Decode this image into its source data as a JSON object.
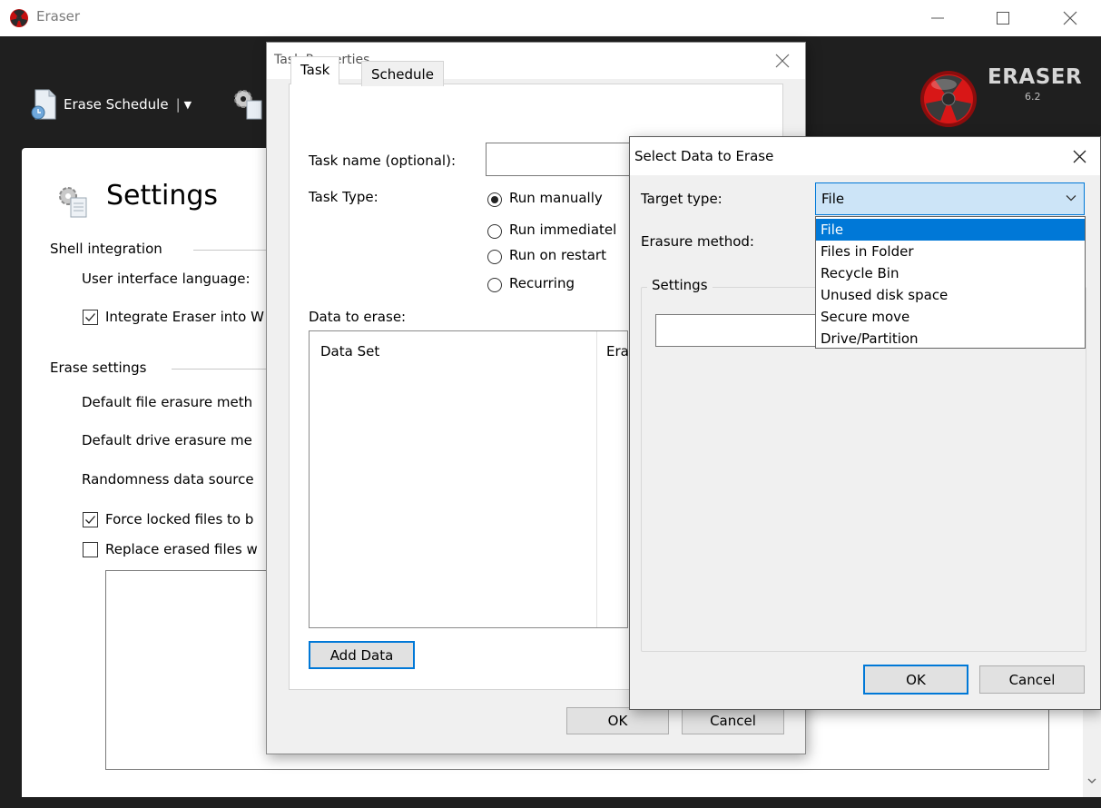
{
  "window": {
    "title": "Eraser",
    "minimize_label": "—",
    "close_label": "✕"
  },
  "toolbar": {
    "erase_schedule_label": "Erase Schedule",
    "separator": "|",
    "dropdown_arrow": "▼"
  },
  "brand": {
    "name": "ERASER",
    "version": "6.2"
  },
  "settings": {
    "title": "Settings",
    "shell_section": "Shell integration",
    "ui_language_label": "User interface language:",
    "integrate_label": "Integrate Eraser into W",
    "integrate_checked": true,
    "erase_section": "Erase settings",
    "default_file_method": "Default file erasure meth",
    "default_drive_method": "Default drive erasure me",
    "randomness_source": "Randomness data source",
    "force_locked_label": "Force locked files to b",
    "force_locked_checked": true,
    "replace_erased_label": "Replace erased files w",
    "replace_erased_checked": false
  },
  "task_dialog": {
    "title": "Task Properties",
    "tabs": [
      {
        "label": "Task",
        "active": true
      },
      {
        "label": "Schedule",
        "active": false
      }
    ],
    "task_name_label": "Task name (optional):",
    "task_name_value": "",
    "task_type_label": "Task Type:",
    "task_types": [
      {
        "label": "Run manually",
        "selected": true
      },
      {
        "label": "Run immediatel",
        "selected": false
      },
      {
        "label": "Run on restart",
        "selected": false
      },
      {
        "label": "Recurring",
        "selected": false
      }
    ],
    "data_to_erase_label": "Data to erase:",
    "columns": [
      "Data Set",
      "Era"
    ],
    "add_data_button": "Add Data",
    "ok_button": "OK",
    "cancel_button": "Cancel"
  },
  "select_dialog": {
    "title": "Select Data to Erase",
    "close_label": "✕",
    "target_type_label": "Target type:",
    "target_type_value": "File",
    "target_type_options": [
      "File",
      "Files in Folder",
      "Recycle Bin",
      "Unused disk space",
      "Secure move",
      "Drive/Partition"
    ],
    "erasure_method_label": "Erasure method:",
    "settings_group_label": "Settings",
    "ok_button": "OK",
    "cancel_button": "Cancel"
  }
}
